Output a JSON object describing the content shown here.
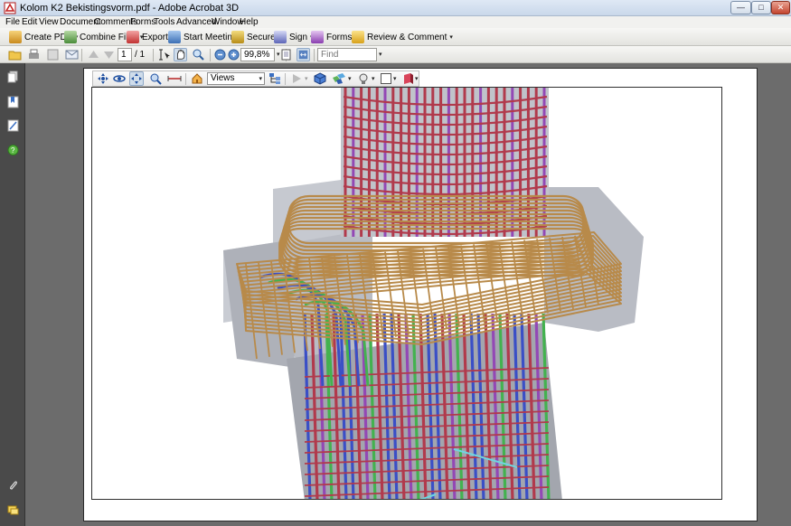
{
  "window": {
    "title": "Kolom K2 Bekistingsvorm.pdf - Adobe Acrobat 3D",
    "min_glyph": "—",
    "max_glyph": "□",
    "close_glyph": "✕"
  },
  "menu": [
    "File",
    "Edit",
    "View",
    "Document",
    "Comments",
    "Forms",
    "Tools",
    "Advanced",
    "Window",
    "Help"
  ],
  "toolbar": {
    "create_pdf": "Create PDF",
    "combine_files": "Combine Files",
    "export": "Export",
    "start_meeting": "Start Meeting",
    "secure": "Secure",
    "sign": "Sign",
    "forms": "Forms",
    "review_comment": "Review & Comment",
    "caret": "▾"
  },
  "nav": {
    "current_page": "1",
    "page_total": "/ 1",
    "zoom": "99,8%",
    "find_placeholder": "Find"
  },
  "toolbar3d": {
    "views_label": "Views"
  },
  "colors": {
    "concrete": "#b9bcc4",
    "concrete_dark": "#8d9099",
    "rebar_red": "#b13a4c",
    "rebar_purple": "#9348b5",
    "rebar_blue": "#3a4fc6",
    "rebar_green": "#43b24f",
    "stirrup_tan": "#b88a4a",
    "cyan": "#6fd6e0"
  }
}
